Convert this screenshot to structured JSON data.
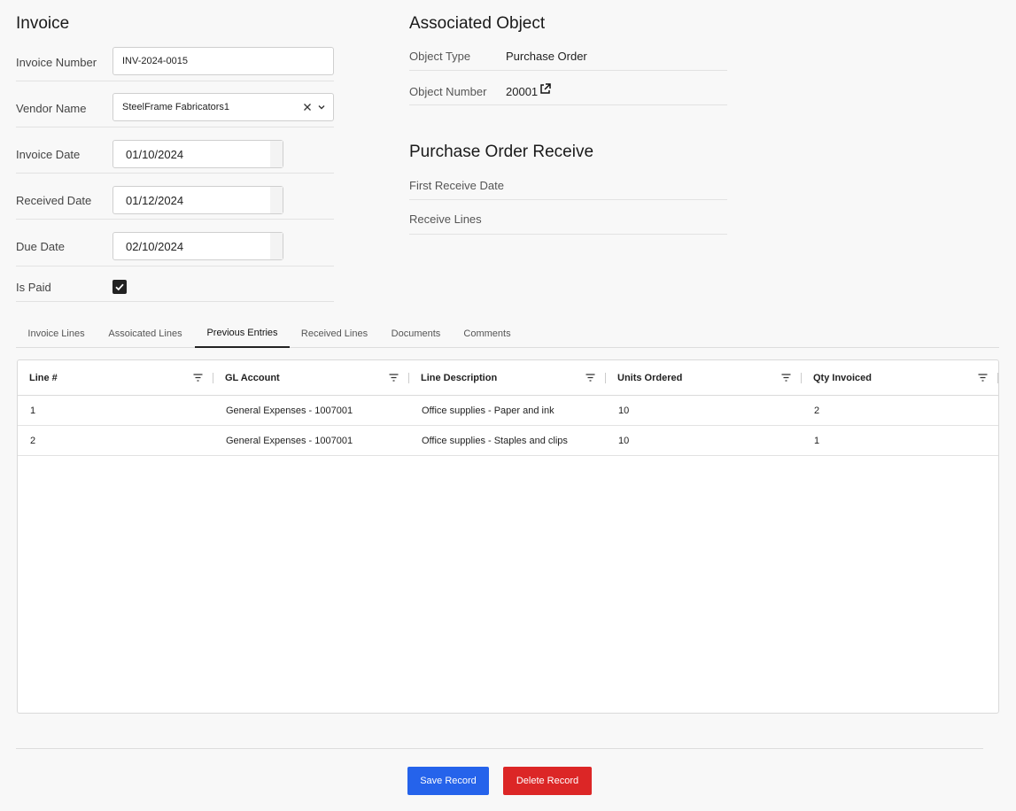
{
  "invoice": {
    "title": "Invoice",
    "fields": {
      "invoice_number": {
        "label": "Invoice Number",
        "value": "INV-2024-0015"
      },
      "vendor_name": {
        "label": "Vendor Name",
        "value": "SteelFrame Fabricators1"
      },
      "invoice_date": {
        "label": "Invoice Date",
        "value": "01/10/2024"
      },
      "received_date": {
        "label": "Received Date",
        "value": "01/12/2024"
      },
      "due_date": {
        "label": "Due Date",
        "value": "02/10/2024"
      },
      "is_paid": {
        "label": "Is Paid",
        "checked": true
      }
    }
  },
  "associated": {
    "title": "Associated Object",
    "object_type": {
      "label": "Object Type",
      "value": "Purchase Order"
    },
    "object_number": {
      "label": "Object Number",
      "value": "20001"
    }
  },
  "po_receive": {
    "title": "Purchase Order Receive",
    "first_receive_date": {
      "label": "First Receive Date",
      "value": ""
    },
    "receive_lines": {
      "label": "Receive Lines",
      "value": ""
    }
  },
  "tabs": [
    {
      "label": "Invoice Lines",
      "active": false
    },
    {
      "label": "Assoicated Lines",
      "active": false
    },
    {
      "label": "Previous Entries",
      "active": true
    },
    {
      "label": "Received Lines",
      "active": false
    },
    {
      "label": "Documents",
      "active": false
    },
    {
      "label": "Comments",
      "active": false
    }
  ],
  "grid": {
    "columns": [
      "Line #",
      "GL Account",
      "Line Description",
      "Units Ordered",
      "Qty Invoiced"
    ],
    "rows": [
      [
        "1",
        "General Expenses - 1007001",
        "Office supplies - Paper and ink",
        "10",
        "2"
      ],
      [
        "2",
        "General Expenses - 1007001",
        "Office supplies - Staples and clips",
        "10",
        "1"
      ]
    ]
  },
  "actions": {
    "save_label": "Save Record",
    "delete_label": "Delete Record"
  },
  "colors": {
    "save": "#2563eb",
    "delete": "#dc2626"
  },
  "icons": {
    "clear": "x-icon",
    "dropdown": "chevron-down-icon",
    "external": "external-link-icon",
    "filter": "filter-icon",
    "check": "check-icon"
  }
}
